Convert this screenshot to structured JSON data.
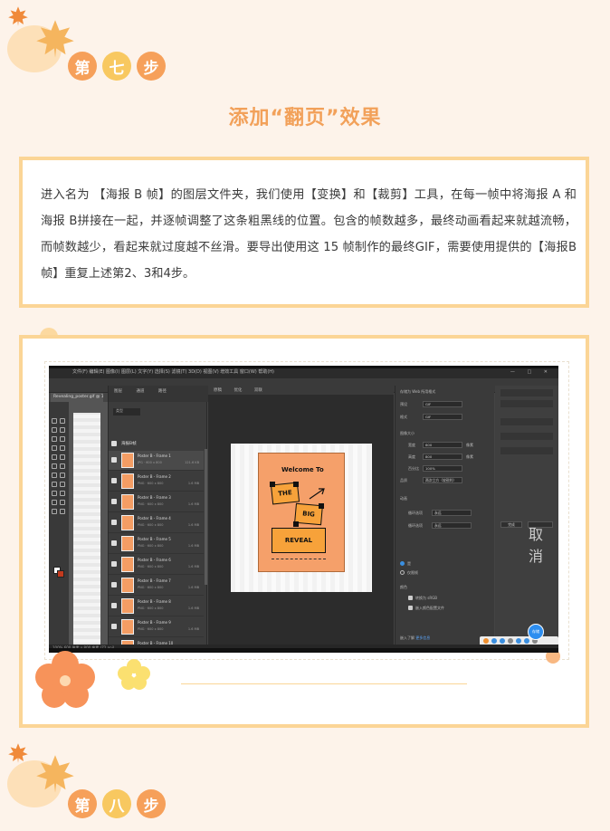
{
  "step_seven": {
    "c1": "第",
    "c2": "七",
    "c3": "步"
  },
  "heading": "添加“翻页”效果",
  "paragraph": "进入名为 【海报 B 帧】的图层文件夹，我们使用【变换】和【裁剪】工具，在每一帧中将海报 A 和海报 B拼接在一起，并逐帧调整了这条粗黑线的位置。包含的帧数越多，最终动画看起来就越流畅，而帧数越少，看起来就过度越不丝滑。要导出使用这 15 帧制作的最终GIF，需要使用提供的【海报B帧】重复上述第2、3和4步。",
  "step_eight": {
    "c1": "第",
    "c2": "八",
    "c3": "步"
  },
  "colors": {
    "accent_orange": "#f6a05a",
    "accent_yellow": "#f8c860",
    "card_border": "#fbd596",
    "background": "#fdf3ea"
  },
  "screenshot": {
    "title_bar": "文件(F)  编辑(E)  图像(I)  图层(L)  文字(Y)  选择(S)  滤镜(T)  3D(D)  视图(V)  增效工具  窗口(W)  帮助(H)",
    "window_controls": "— □ ✕",
    "doc_tab": "Revealing_poster.gif @ 100%",
    "layers_panel": {
      "tabs": [
        "图层",
        "通道",
        "路径"
      ],
      "search": "类型",
      "folder": "海报B帧",
      "rows": [
        {
          "name": "Poster B - Frame 1",
          "sub": "JPG  ·  600 x 800",
          "size": "121.6 KB"
        },
        {
          "name": "Poster B - Frame 2",
          "sub": "PNG  ·  600 x 800",
          "size": "1.6 MB"
        },
        {
          "name": "Poster B - Frame 3",
          "sub": "PNG  ·  600 x 800",
          "size": "1.6 MB"
        },
        {
          "name": "Poster B - Frame 4",
          "sub": "PNG  ·  600 x 800",
          "size": "1.6 MB"
        },
        {
          "name": "Poster B - Frame 5",
          "sub": "PNG  ·  600 x 800",
          "size": "1.6 MB"
        },
        {
          "name": "Poster B - Frame 6",
          "sub": "PNG  ·  600 x 800",
          "size": "1.6 MB"
        },
        {
          "name": "Poster B - Frame 7",
          "sub": "PNG  ·  600 x 800",
          "size": "1.6 MB"
        },
        {
          "name": "Poster B - Frame 8",
          "sub": "PNG  ·  600 x 800",
          "size": "1.6 MB"
        },
        {
          "name": "Poster B - Frame 9",
          "sub": "PNG  ·  600 x 800",
          "size": "1.6 MB"
        },
        {
          "name": "Poster B - Frame 10",
          "sub": "PNG  ·  600 x 800",
          "size": "1.6 MB"
        }
      ]
    },
    "canvas_tabs": [
      "原稿",
      "优化",
      "双联"
    ],
    "poster": {
      "line1": "Welcome To",
      "line2": "THE",
      "line3": "BIG",
      "line4": "REVEAL"
    },
    "props": {
      "header": "存储为 Web 所用格式",
      "preset_label": "预设",
      "preset_value": "GIF",
      "format_label": "格式",
      "format_value": "GIF",
      "size_label": "图像大小",
      "w_label": "宽度",
      "w_value": "600",
      "h_label": "高度",
      "h_value": "800",
      "unit": "像素",
      "pct_label": "百分比",
      "pct_value": "100%",
      "quality_label": "品质",
      "quality_value": "两次立方（较锐利）",
      "anim_label": "动画",
      "loop_label": "循环选项",
      "loop_value": "永远",
      "radio1": "是",
      "radio2": "仅限帧",
      "color_label": "颜色",
      "check1": "转换为 sRGB",
      "check2": "嵌入颜色配置文件",
      "link_prefix": "嵌入了解",
      "link_text": "更多信息"
    },
    "right_btn": "完成",
    "right_btn2": "取消",
    "status": "100%   600 像素 x 800 像素 (72 ppi)",
    "blue_button": "存储"
  }
}
